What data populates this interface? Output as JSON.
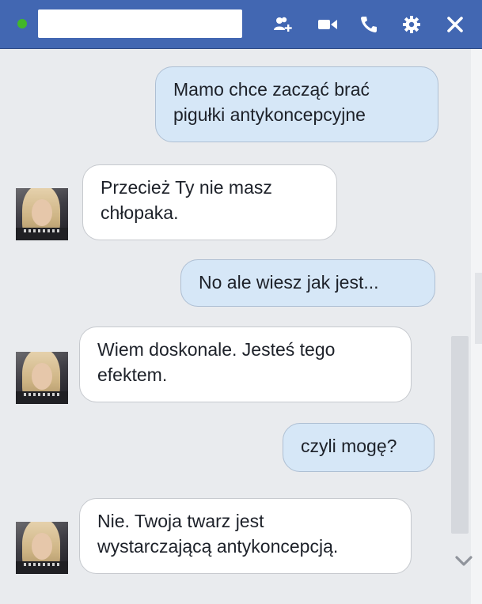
{
  "header": {
    "icons": [
      "add-person-icon",
      "video-camera-icon",
      "phone-icon",
      "gear-icon",
      "close-icon"
    ],
    "colors": {
      "bar": "#4267b2",
      "online": "#42b72a"
    }
  },
  "messages": [
    {
      "direction": "out",
      "line1": "Mamo chce zacząć brać",
      "line2": "pigułki antykoncepcyjne"
    },
    {
      "direction": "in",
      "line1": "Przecież Ty nie masz",
      "line2": "chłopaka."
    },
    {
      "direction": "out",
      "line1": "No ale wiesz jak jest..."
    },
    {
      "direction": "in",
      "line1": "Wiem doskonale. Jesteś tego",
      "line2": "efektem."
    },
    {
      "direction": "out",
      "line1": "czyli mogę?"
    },
    {
      "direction": "in",
      "line1": "Nie. Twoja twarz jest",
      "line2": "wystarczającą antykoncepcją."
    }
  ],
  "colors": {
    "outgoing_bubble": "#d6e7f7",
    "incoming_bubble": "#ffffff",
    "background": "#e9ebee"
  }
}
